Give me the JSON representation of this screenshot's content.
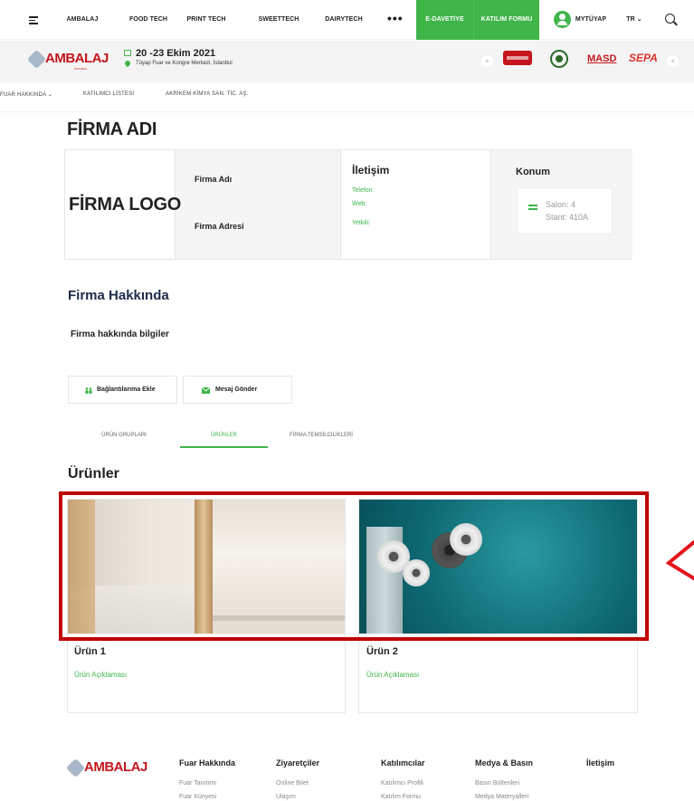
{
  "nav": {
    "items": [
      "AMBALAJ",
      "FOOD TECH",
      "PRINT TECH",
      "SWEETTECH",
      "DAIRYTECH"
    ],
    "more": "•••",
    "edavetiye": "E-DAVETİYE",
    "katilim": "KATILIM FORMU",
    "mytuyap": "MYTÜYAP",
    "lang": "TR ⌄",
    "accent": "#3fb54a"
  },
  "event": {
    "logo_text": "AMBALAJ",
    "logo_sub": "İSTANBUL",
    "date": "20 -23 Ekim 2021",
    "venue": "Tüyap Fuar ve Kongre Merkezi, İstanbul",
    "sponsor_masd": "MASD",
    "sponsor_sepa": "SEPA",
    "brand_color": "#c4161c"
  },
  "breadcrumb": [
    "FUAR HAKKINDA ⌄",
    "KATILIMCI LİSTESİ",
    "AKRİKEM KİMYA SAN. TİC. AŞ."
  ],
  "firma": {
    "heading": "FİRMA ADI",
    "logo_placeholder": "FİRMA LOGO",
    "name_label": "Firma Adı",
    "address_label": "Firma Adresi",
    "contact_heading": "İletişim",
    "phone_label": "Telefon:",
    "web_label": "Web:",
    "rep_label": "Yetkili:",
    "location_heading": "Konum",
    "salon": "Salon: 4",
    "stand": "Stant: 410A"
  },
  "about": {
    "heading": "Firma Hakkında",
    "text": "Firma hakkında bilgiler",
    "add_button": "Bağlantılarıma Ekle",
    "message_button": "Mesaj Gönder"
  },
  "tabs": [
    "ÜRÜN GRUPLARI",
    "ÜRÜNLER",
    "FİRMA TEMSİLCİLİKLERİ"
  ],
  "products": {
    "heading": "Ürünler",
    "items": [
      {
        "title": "Ürün 1",
        "desc": "Ürün Açıklaması"
      },
      {
        "title": "Ürün 2",
        "desc": "Ürün Açıklaması"
      }
    ],
    "highlight_color": "#c00000"
  },
  "footer": {
    "logo_text": "AMBALAJ",
    "columns": [
      {
        "head": "Fuar Hakkında",
        "links": [
          "Fuar Tanıtımı",
          "Fuar Künyesi"
        ]
      },
      {
        "head": "Ziyaretçiler",
        "links": [
          "Online Bilet",
          "Ulaşım"
        ]
      },
      {
        "head": "Katılımcılar",
        "links": [
          "Katılımcı Profili",
          "Katılım Formu"
        ]
      },
      {
        "head": "Medya & Basın",
        "links": [
          "Basın Bültenleri",
          "Medya Materyalleri"
        ]
      },
      {
        "head": "İletişim",
        "links": []
      }
    ]
  }
}
